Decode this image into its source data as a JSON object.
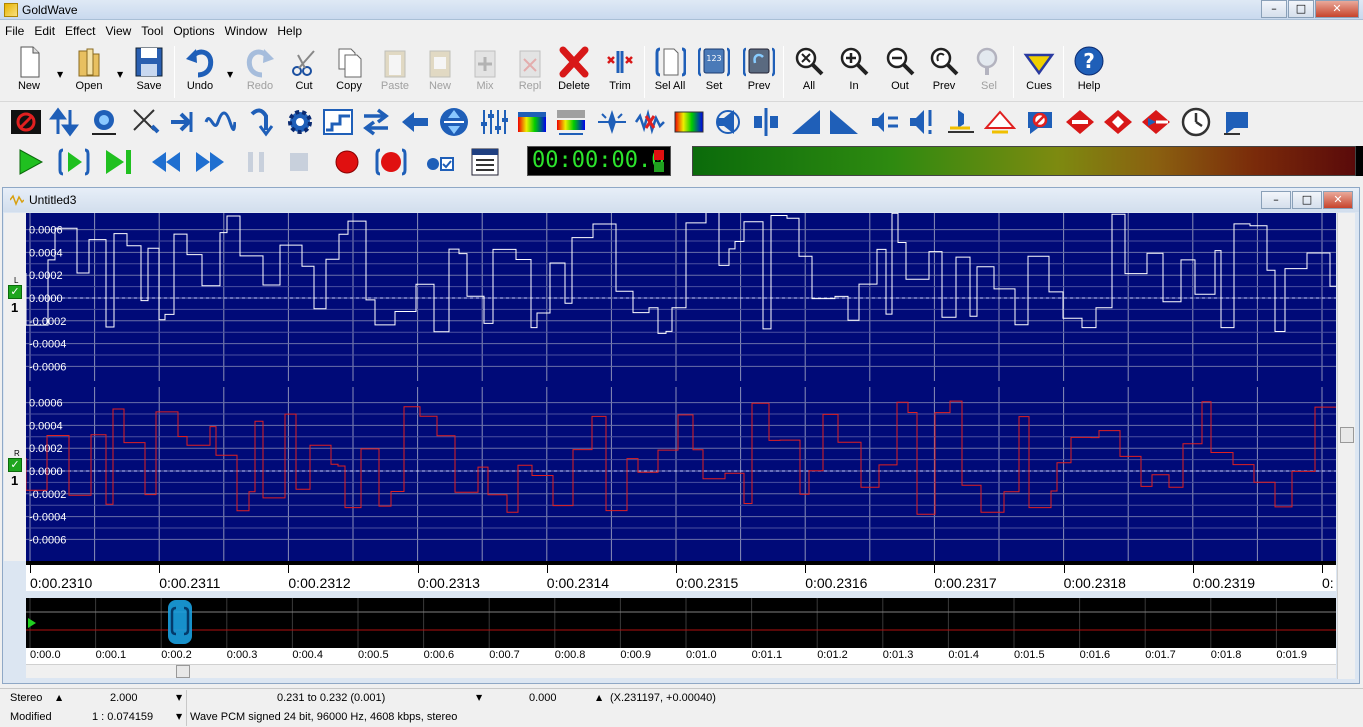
{
  "window": {
    "title": "GoldWave",
    "minimize": "–",
    "maximize": "□",
    "close": "✕"
  },
  "menu": [
    "File",
    "Edit",
    "Effect",
    "View",
    "Tool",
    "Options",
    "Window",
    "Help"
  ],
  "toolbar": {
    "new": "New",
    "open": "Open",
    "save": "Save",
    "undo": "Undo",
    "redo": "Redo",
    "cut": "Cut",
    "copy": "Copy",
    "paste": "Paste",
    "paste_new": "New",
    "mix": "Mix",
    "replace": "Repl",
    "delete": "Delete",
    "trim": "Trim",
    "sel_all": "Sel All",
    "set": "Set",
    "prev": "Prev",
    "zoom_all": "All",
    "zoom_in": "In",
    "zoom_out": "Out",
    "zoom_prev": "Prev",
    "zoom_sel": "Sel",
    "cues": "Cues",
    "help": "Help",
    "set_badge": "123"
  },
  "transport": {
    "time": "00:00:00.0"
  },
  "document": {
    "title": "Untitled3",
    "left_channel": {
      "letter": "L",
      "number": "1"
    },
    "right_channel": {
      "letter": "R",
      "number": "1"
    },
    "amplitude_labels": [
      "0.0006",
      "0.0004",
      "0.0002",
      "0.0000",
      "-0.0002",
      "-0.0004",
      "-0.0006"
    ],
    "time_labels": [
      "0:00.2310",
      "0:00.2311",
      "0:00.2312",
      "0:00.2313",
      "0:00.2314",
      "0:00.2315",
      "0:00.2316",
      "0:00.2317",
      "0:00.2318",
      "0:00.2319",
      "0:"
    ],
    "overview_labels": [
      "0:00.0",
      "0:00.1",
      "0:00.2",
      "0:00.3",
      "0:00.4",
      "0:00.5",
      "0:00.6",
      "0:00.7",
      "0:00.8",
      "0:00.9",
      "0:01.0",
      "0:01.1",
      "0:01.2",
      "0:01.3",
      "0:01.4",
      "0:01.5",
      "0:01.6",
      "0:01.7",
      "0:01.8",
      "0:01.9"
    ]
  },
  "status": {
    "channels": "Stereo",
    "length": "2.000",
    "selection": "0.231 to 0.232 (0.001)",
    "position": "0.000",
    "cursor": "(X.231197, +0.00040)",
    "state": "Modified",
    "zoom": "1 : 0.074159",
    "format": "Wave PCM signed 24 bit, 96000 Hz, 4608 kbps, stereo"
  },
  "colors": {
    "waveform_bg": "#000a78",
    "left_wave": "#ffffff",
    "right_wave": "#e02020",
    "time_green": "#2ce42c"
  }
}
